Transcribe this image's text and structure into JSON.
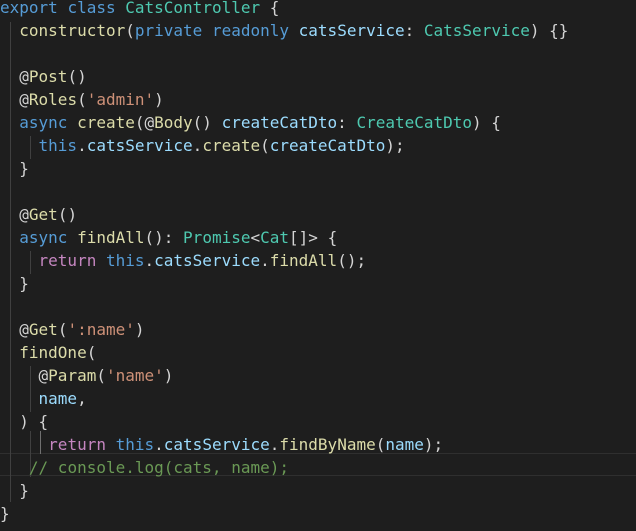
{
  "editor": {
    "theme": {
      "background": "#1e1e1e",
      "text": "#d4d4d4",
      "keyword": "#569cd6",
      "control": "#c586c0",
      "type": "#4ec9b0",
      "function": "#dcdcaa",
      "variable": "#9cdcfe",
      "string": "#ce9178",
      "comment": "#6a9955"
    },
    "lines": [
      [
        [
          "kw",
          "export"
        ],
        [
          "pun",
          " "
        ],
        [
          "kw",
          "class"
        ],
        [
          "pun",
          " "
        ],
        [
          "cls",
          "CatsController"
        ],
        [
          "pun",
          " {"
        ]
      ],
      [
        [
          "pun",
          "  "
        ],
        [
          "fn",
          "constructor"
        ],
        [
          "pun",
          "("
        ],
        [
          "kw",
          "private"
        ],
        [
          "pun",
          " "
        ],
        [
          "kw",
          "readonly"
        ],
        [
          "pun",
          " "
        ],
        [
          "var",
          "catsService"
        ],
        [
          "pun",
          ": "
        ],
        [
          "cls",
          "CatsService"
        ],
        [
          "pun",
          ") {}"
        ]
      ],
      [],
      [
        [
          "pun",
          "  @"
        ],
        [
          "fn",
          "Post"
        ],
        [
          "pun",
          "()"
        ]
      ],
      [
        [
          "pun",
          "  @"
        ],
        [
          "fn",
          "Roles"
        ],
        [
          "pun",
          "("
        ],
        [
          "str",
          "'admin'"
        ],
        [
          "pun",
          ")"
        ]
      ],
      [
        [
          "pun",
          "  "
        ],
        [
          "kw",
          "async"
        ],
        [
          "pun",
          " "
        ],
        [
          "fn",
          "create"
        ],
        [
          "pun",
          "(@"
        ],
        [
          "fn",
          "Body"
        ],
        [
          "pun",
          "() "
        ],
        [
          "var",
          "createCatDto"
        ],
        [
          "pun",
          ": "
        ],
        [
          "cls",
          "CreateCatDto"
        ],
        [
          "pun",
          ") {"
        ]
      ],
      [
        [
          "pun",
          "    "
        ],
        [
          "kw",
          "this"
        ],
        [
          "pun",
          "."
        ],
        [
          "var",
          "catsService"
        ],
        [
          "pun",
          "."
        ],
        [
          "fn",
          "create"
        ],
        [
          "pun",
          "("
        ],
        [
          "var",
          "createCatDto"
        ],
        [
          "pun",
          ");"
        ]
      ],
      [
        [
          "pun",
          "  }"
        ]
      ],
      [],
      [
        [
          "pun",
          "  @"
        ],
        [
          "fn",
          "Get"
        ],
        [
          "pun",
          "()"
        ]
      ],
      [
        [
          "pun",
          "  "
        ],
        [
          "kw",
          "async"
        ],
        [
          "pun",
          " "
        ],
        [
          "fn",
          "findAll"
        ],
        [
          "pun",
          "(): "
        ],
        [
          "cls",
          "Promise"
        ],
        [
          "pun",
          "<"
        ],
        [
          "cls",
          "Cat"
        ],
        [
          "pun",
          "[]> {"
        ]
      ],
      [
        [
          "pun",
          "    "
        ],
        [
          "ctl",
          "return"
        ],
        [
          "pun",
          " "
        ],
        [
          "kw",
          "this"
        ],
        [
          "pun",
          "."
        ],
        [
          "var",
          "catsService"
        ],
        [
          "pun",
          "."
        ],
        [
          "fn",
          "findAll"
        ],
        [
          "pun",
          "();"
        ]
      ],
      [
        [
          "pun",
          "  }"
        ]
      ],
      [],
      [
        [
          "pun",
          "  @"
        ],
        [
          "fn",
          "Get"
        ],
        [
          "pun",
          "("
        ],
        [
          "str",
          "':name'"
        ],
        [
          "pun",
          ")"
        ]
      ],
      [
        [
          "pun",
          "  "
        ],
        [
          "fn",
          "findOne"
        ],
        [
          "pun",
          "("
        ]
      ],
      [
        [
          "pun",
          "    @"
        ],
        [
          "fn",
          "Param"
        ],
        [
          "pun",
          "("
        ],
        [
          "str",
          "'name'"
        ],
        [
          "pun",
          ")"
        ]
      ],
      [
        [
          "pun",
          "    "
        ],
        [
          "var",
          "name"
        ],
        [
          "pun",
          ","
        ]
      ],
      [
        [
          "pun",
          "  ) {"
        ]
      ],
      [
        [
          "pun",
          "     "
        ],
        [
          "ctl",
          "return"
        ],
        [
          "pun",
          " "
        ],
        [
          "kw",
          "this"
        ],
        [
          "pun",
          "."
        ],
        [
          "var",
          "catsService"
        ],
        [
          "pun",
          "."
        ],
        [
          "fn",
          "findByName"
        ],
        [
          "pun",
          "("
        ],
        [
          "var",
          "name"
        ],
        [
          "pun",
          ");"
        ]
      ],
      [
        [
          "pun",
          "   "
        ],
        [
          "cmt",
          "// console.log(cats, name);"
        ]
      ],
      [
        [
          "pun",
          "  }"
        ]
      ],
      [
        [
          "pun",
          "}"
        ]
      ]
    ]
  }
}
